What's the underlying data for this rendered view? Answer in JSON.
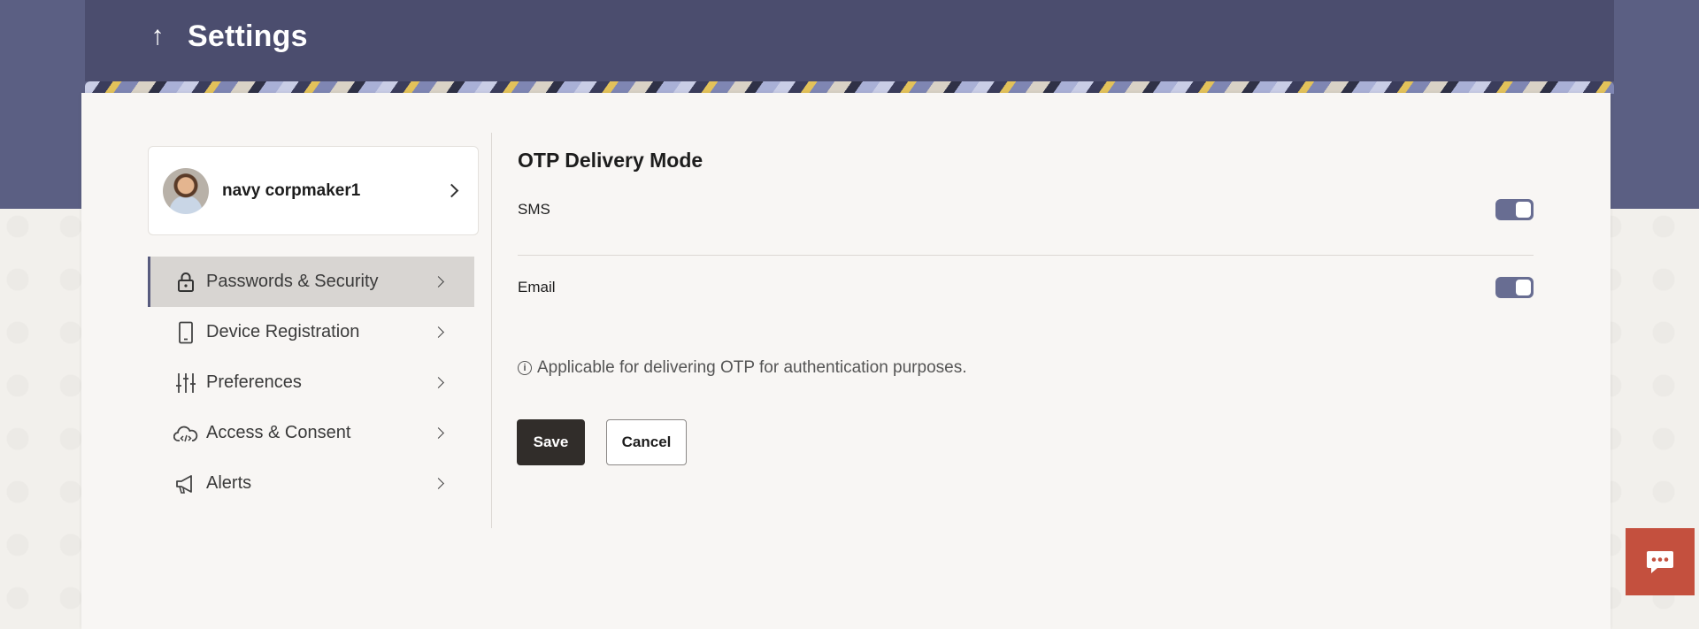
{
  "header": {
    "back_icon": "arrow-up-icon",
    "title": "Settings"
  },
  "profile": {
    "name": "navy corpmaker1",
    "avatar_icon": "user-avatar"
  },
  "sidebar": {
    "items": [
      {
        "label": "Passwords & Security",
        "icon": "lock-icon",
        "active": true
      },
      {
        "label": "Device Registration",
        "icon": "phone-icon",
        "active": false
      },
      {
        "label": "Preferences",
        "icon": "sliders-icon",
        "active": false
      },
      {
        "label": "Access & Consent",
        "icon": "cloud-code-icon",
        "active": false
      },
      {
        "label": "Alerts",
        "icon": "megaphone-icon",
        "active": false
      }
    ]
  },
  "main": {
    "section_title": "OTP Delivery Mode",
    "options": [
      {
        "label": "SMS",
        "enabled": true
      },
      {
        "label": "Email",
        "enabled": true
      }
    ],
    "info_text": "Applicable for delivering OTP for authentication purposes.",
    "save_label": "Save",
    "cancel_label": "Cancel"
  },
  "colors": {
    "header_bg": "#4b4d6e",
    "accent": "#686d92",
    "primary_button": "#312d2a",
    "chat_button": "#c4503e"
  },
  "chat": {
    "icon": "chat-bubble-icon"
  }
}
